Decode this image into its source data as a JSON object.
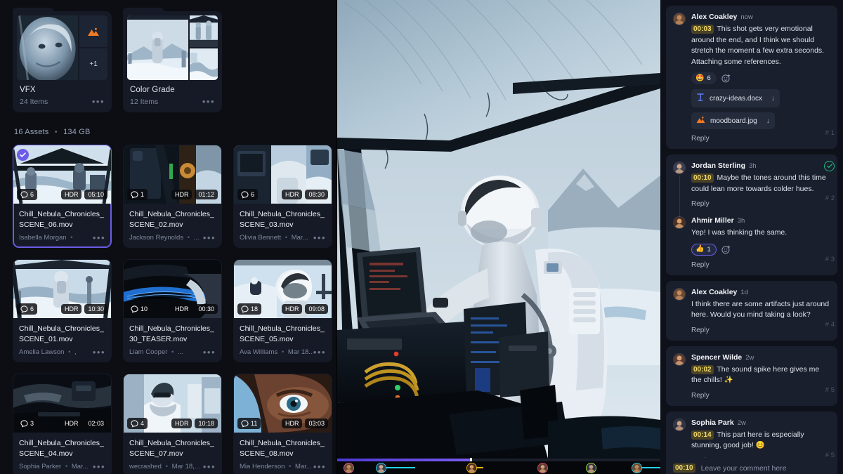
{
  "browser": {
    "folders": [
      {
        "name": "VFX",
        "items": "24 Items",
        "overflow": "+1",
        "menu": "•••"
      },
      {
        "name": "Color Grade",
        "items": "12 Items",
        "overflow": "",
        "menu": "•••"
      }
    ],
    "assets_summary": {
      "count": "16 Assets",
      "separator": "•",
      "size": "134 GB"
    },
    "assets": [
      {
        "title": "Chill_Nebula_Chronicles_SCENE_06.mov",
        "owner": "Isabella Morgan",
        "date": "",
        "comments": "6",
        "hdr": "HDR",
        "duration": "05:10",
        "selected": true,
        "scene": "dome"
      },
      {
        "title": "Chill_Nebula_Chronicles_SCENE_02.mov",
        "owner": "Jackson Reynolds",
        "date": "...",
        "comments": "1",
        "hdr": "HDR",
        "duration": "01:12",
        "selected": false,
        "scene": "rig"
      },
      {
        "title": "Chill_Nebula_Chronicles_SCENE_03.mov",
        "owner": "Olivia Bennett",
        "date": "Mar...",
        "comments": "6",
        "hdr": "HDR",
        "duration": "08:30",
        "selected": false,
        "scene": "console"
      },
      {
        "title": "Chill_Nebula_Chronicles_SCENE_01.mov",
        "owner": "Amelia Lawson",
        "date": ",",
        "comments": "6",
        "hdr": "HDR",
        "duration": "10:30",
        "selected": false,
        "scene": "standing"
      },
      {
        "title": "Chill_Nebula_Chronicles_30_TEASER.mov",
        "owner": "Liam Cooper",
        "date": "...",
        "comments": "10",
        "hdr": "HDR",
        "duration": "00:30",
        "selected": false,
        "scene": "cable"
      },
      {
        "title": "Chill_Nebula_Chronicles_SCENE_05.mov",
        "owner": "Ava Williams",
        "date": "Mar 18...",
        "comments": "18",
        "hdr": "HDR",
        "duration": "09:08",
        "selected": false,
        "scene": "helmet"
      },
      {
        "title": "Chill_Nebula_Chronicles_SCENE_04.mov",
        "owner": "Sophia Parker",
        "date": "Mar...",
        "comments": "3",
        "hdr": "HDR",
        "duration": "02:03",
        "selected": false,
        "scene": "dark"
      },
      {
        "title": "Chill_Nebula_Chronicles_SCENE_07.mov",
        "owner": "wecrashed",
        "date": "Mar 18,...",
        "comments": "4",
        "hdr": "HDR",
        "duration": "10:18",
        "selected": false,
        "scene": "scarf"
      },
      {
        "title": "Chill_Nebula_Chronicles_SCENE_08.mov",
        "owner": "Mia Henderson",
        "date": "Mar...",
        "comments": "11",
        "hdr": "HDR",
        "duration": "03:03",
        "selected": false,
        "scene": "eye"
      }
    ]
  },
  "player": {
    "progress_percent": 41,
    "markers": [
      {
        "left_percent": 2,
        "ring_color": "#e05f9a",
        "line_color": "#e05f9a",
        "line_width": 0
      },
      {
        "left_percent": 12,
        "ring_color": "#22d3ee",
        "line_color": "#22d3ee",
        "line_width": 42
      },
      {
        "left_percent": 40,
        "ring_color": "#eab308",
        "line_color": "#eab308",
        "line_width": 10
      },
      {
        "left_percent": 62,
        "ring_color": "#d9486b",
        "line_color": "#d9486b",
        "line_width": 0
      },
      {
        "left_percent": 77,
        "ring_color": "#a3e635",
        "line_color": "#a3e635",
        "line_width": 0
      },
      {
        "left_percent": 91,
        "ring_color": "#22d3ee",
        "line_color": "#22d3ee",
        "line_width": 30
      }
    ]
  },
  "comments": {
    "groups": [
      {
        "index_label": "# 1",
        "approved": false,
        "thread": [
          {
            "author": "Alex Coakley",
            "time": "now",
            "timestamp": "00:03",
            "text": "This shot gets very emotional around the end, and I think we should stretch the moment a few extra seconds.  Attaching some references.",
            "reactions": [
              {
                "emoji": "🤩",
                "count": "6",
                "voted": false
              }
            ],
            "add_reaction_label": "add-reaction",
            "attachments": [
              {
                "name": "crazy-ideas.docx",
                "icon": "doc",
                "download": "↓"
              },
              {
                "name": "moodboard.jpg",
                "icon": "image",
                "download": "↓"
              }
            ],
            "reply": "Reply",
            "avatar": "alex"
          }
        ]
      },
      {
        "index_label": "# 2",
        "approved": true,
        "thread": [
          {
            "author": "Jordan Sterling",
            "time": "3h",
            "timestamp": "00:10",
            "text": "Maybe the tones around this time could lean more towards colder hues.",
            "reactions": [],
            "attachments": [],
            "reply": "Reply",
            "avatar": "jordan",
            "index_label": "# 2"
          },
          {
            "author": "Ahmir Miller",
            "time": "3h",
            "timestamp": "",
            "text": "Yep! I was thinking the same.",
            "reactions": [
              {
                "emoji": "👍",
                "count": "1",
                "voted": true
              }
            ],
            "attachments": [],
            "reply": "Reply",
            "avatar": "ahmir",
            "index_label": "# 3"
          }
        ]
      },
      {
        "index_label": "# 4",
        "approved": false,
        "thread": [
          {
            "author": "Alex Coakley",
            "time": "1d",
            "timestamp": "",
            "text": "I think there are some artifacts just around here. Would you mind taking a look?",
            "reactions": [],
            "attachments": [],
            "reply": "Reply",
            "avatar": "alex"
          }
        ]
      },
      {
        "index_label": "# 5",
        "approved": false,
        "thread": [
          {
            "author": "Spencer Wilde",
            "time": "2w",
            "timestamp": "00:02",
            "text": "The sound spike here gives me the chills! ✨",
            "reactions": [],
            "attachments": [],
            "reply": "Reply",
            "avatar": "spencer"
          }
        ]
      },
      {
        "index_label": "# 5",
        "approved": false,
        "thread": [
          {
            "author": "Sophia Park",
            "time": "2w",
            "timestamp": "00:14",
            "text": "This part here is especially stunning, good job! 😊",
            "reactions": [],
            "attachments": [],
            "reply": "Reply",
            "avatar": "sophia"
          }
        ]
      }
    ],
    "composer": {
      "timestamp": "00:10",
      "placeholder": "Leave your comment here"
    }
  },
  "colors": {
    "accent": "#6c5ce7",
    "timestamp_text": "#f3da6a",
    "approve_green": "#1db87a",
    "panel": "#1a1f2d",
    "surface": "#161a26",
    "background": "#0c0e14"
  }
}
